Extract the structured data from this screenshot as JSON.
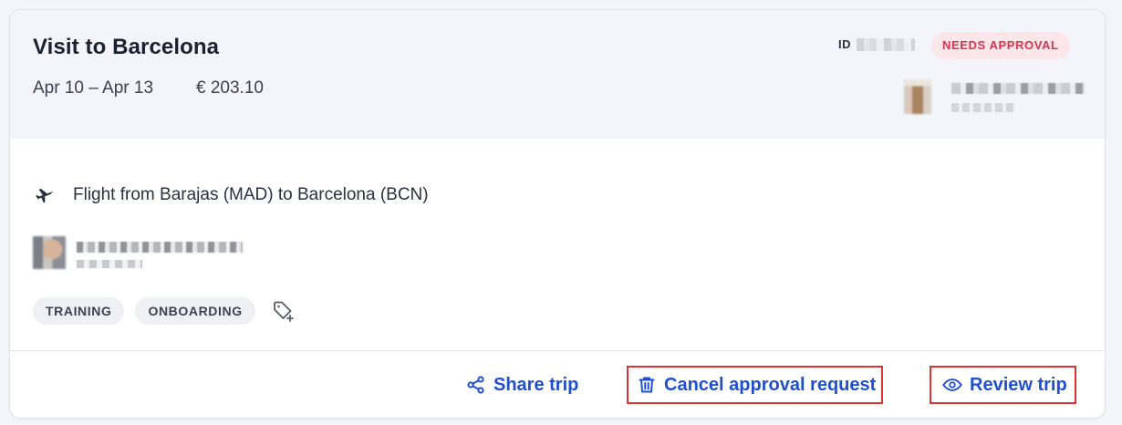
{
  "trip": {
    "title": "Visit to Barcelona",
    "dates": "Apr 10 – Apr 13",
    "price": "€ 203.10",
    "id_label": "ID",
    "status": "NEEDS APPROVAL"
  },
  "segment": {
    "flight_text": "Flight from Barajas (MAD) to Barcelona (BCN)",
    "icon": "airplane-icon"
  },
  "tags": [
    "TRAINING",
    "ONBOARDING"
  ],
  "actions": {
    "share": "Share trip",
    "cancel": "Cancel approval request",
    "review": "Review trip"
  },
  "colors": {
    "accent": "#1f4fd1",
    "status_bg": "#fde6ea",
    "status_text": "#d8344f",
    "header_bg": "#f3f5fa",
    "highlight_border": "#dd3333"
  }
}
